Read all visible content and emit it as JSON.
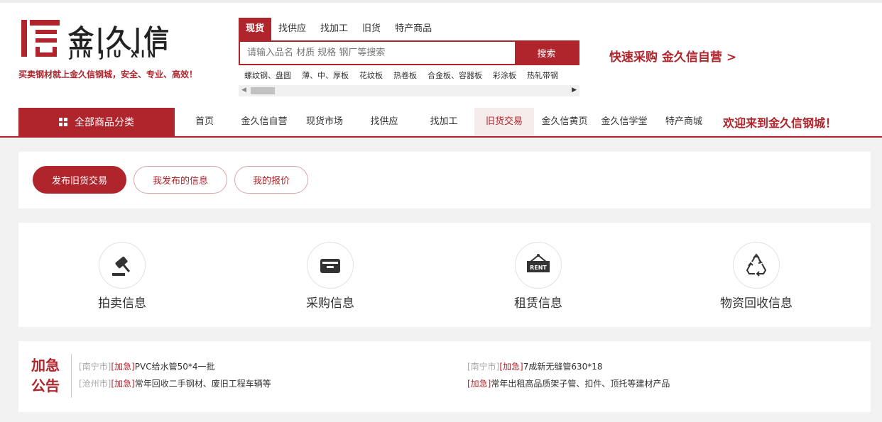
{
  "logo": {
    "cn": "金|久|信",
    "en": "JIN JIU XIN",
    "slogan": "买卖钢材就上金久信钢城，安全、专业、高效！"
  },
  "search": {
    "tabs": [
      "现货",
      "找供应",
      "找加工",
      "旧货",
      "特产商品"
    ],
    "placeholder": "请输入品名 材质 规格 钢厂等搜索",
    "button": "搜索",
    "hot_words": [
      "螺纹钢、盘圆",
      "薄、中、厚板",
      "花纹板",
      "热卷板",
      "合金板、容器板",
      "彩涂板",
      "热轧带钢"
    ]
  },
  "quick_buy": "快速采购 金久信自营 >",
  "nav": {
    "all_categories": "全部商品分类",
    "items": [
      "首页",
      "金久信自营",
      "现货市场",
      "找供应",
      "找加工",
      "旧货交易",
      "金久信黄页",
      "金久信学堂",
      "特产商城"
    ],
    "active": "旧货交易",
    "welcome": "欢迎来到金久信钢城！"
  },
  "actions": [
    "发布旧货交易",
    "我发布的信息",
    "我的报价"
  ],
  "categories": [
    {
      "label": "拍卖信息",
      "icon": "auction-hammer-icon"
    },
    {
      "label": "采购信息",
      "icon": "inbox-tray-icon"
    },
    {
      "label": "租赁信息",
      "icon": "rent-sign-icon",
      "icon_text": "RENT"
    },
    {
      "label": "物资回收信息",
      "icon": "recycle-icon"
    }
  ],
  "notices": {
    "title_line1": "加急",
    "title_line2": "公告",
    "items": [
      {
        "city": "[南宁市]",
        "tag": "[加急]",
        "text": "PVC给水管50*4一批"
      },
      {
        "city": "[沧州市]",
        "tag": "[加急]",
        "text": "常年回收二手钢材、废旧工程车辆等"
      },
      {
        "city": "[南宁市]",
        "tag": "[加急]",
        "text": "7成新无缝管630*18"
      },
      {
        "city": "",
        "tag": "[加急]",
        "text": "常年出租高品质架子管、扣件、顶托等建材产品"
      }
    ]
  },
  "colors": {
    "brand": "#b0242b",
    "background": "#f2f2f2"
  }
}
